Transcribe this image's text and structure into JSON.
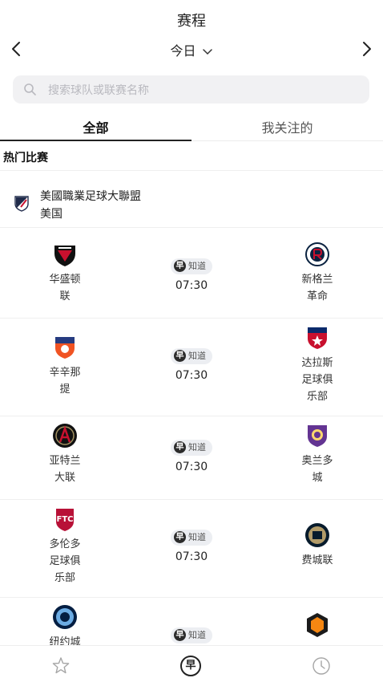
{
  "header": {
    "title": "赛程",
    "date_label": "今日"
  },
  "search": {
    "placeholder": "搜索球队或联赛名称"
  },
  "tabs": [
    {
      "label": "全部",
      "active": true
    },
    {
      "label": "我关注的",
      "active": false
    }
  ],
  "section_title": "热门比赛",
  "league": {
    "name": "美國職業足球大聯盟",
    "country": "美国"
  },
  "badge": {
    "glyph": "早",
    "label": "知道"
  },
  "matches": [
    {
      "home": [
        "华盛顿",
        "联"
      ],
      "away": [
        "新格兰",
        "革命"
      ],
      "time": "07:30"
    },
    {
      "home": [
        "辛辛那",
        "提"
      ],
      "away": [
        "达拉斯",
        "足球俱",
        "乐部"
      ],
      "time": "07:30"
    },
    {
      "home": [
        "亚特兰",
        "大联"
      ],
      "away": [
        "奥兰多",
        "城"
      ],
      "time": "07:30"
    },
    {
      "home": [
        "多伦多",
        "足球俱",
        "乐部"
      ],
      "away": [
        "费城联"
      ],
      "time": "07:30"
    },
    {
      "home": [
        "纽约城"
      ],
      "away": [],
      "time": ""
    }
  ],
  "bottom_nav": [
    {
      "icon": "star-icon"
    },
    {
      "icon": "zao-icon",
      "glyph": "早"
    },
    {
      "icon": "clock-icon"
    }
  ],
  "colors": {
    "accent": "#222222",
    "search_bg": "#f1f1f3",
    "badge_bg": "#eceef2",
    "placeholder": "#b9b9bf"
  }
}
